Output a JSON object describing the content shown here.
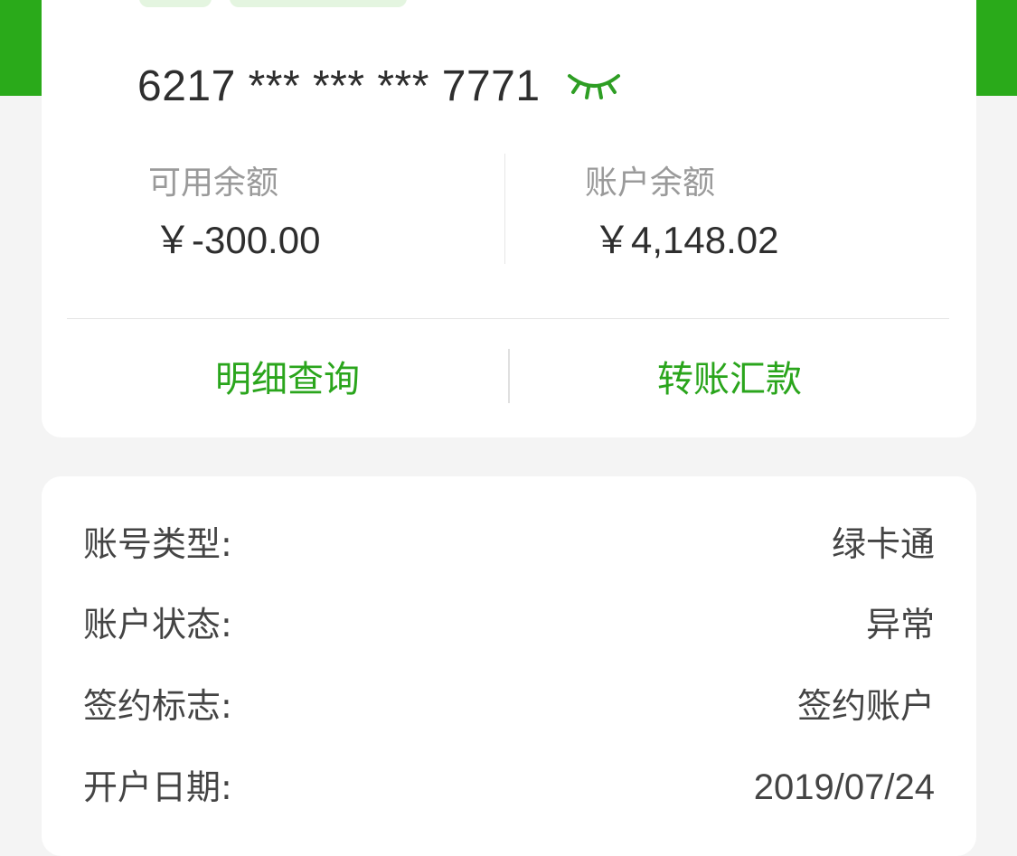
{
  "colors": {
    "brand_green": "#2aaa1a",
    "action_green": "#2aa51c",
    "text_dark": "#2e2e2e",
    "text_gray": "#9a9a9a",
    "background": "#f4f4f4"
  },
  "account_card": {
    "card_number": "6217 *** *** *** 7771",
    "visibility_icon": "eye-closed-icon",
    "available_balance": {
      "label": "可用余额",
      "value": "￥-300.00"
    },
    "account_balance": {
      "label": "账户余额",
      "value": "￥4,148.02"
    },
    "actions": {
      "detail_query": "明细查询",
      "transfer": "转账汇款"
    }
  },
  "account_info": [
    {
      "label": "账号类型:",
      "value": "绿卡通"
    },
    {
      "label": "账户状态:",
      "value": "异常"
    },
    {
      "label": "签约标志:",
      "value": "签约账户"
    },
    {
      "label": "开户日期:",
      "value": "2019/07/24"
    }
  ]
}
